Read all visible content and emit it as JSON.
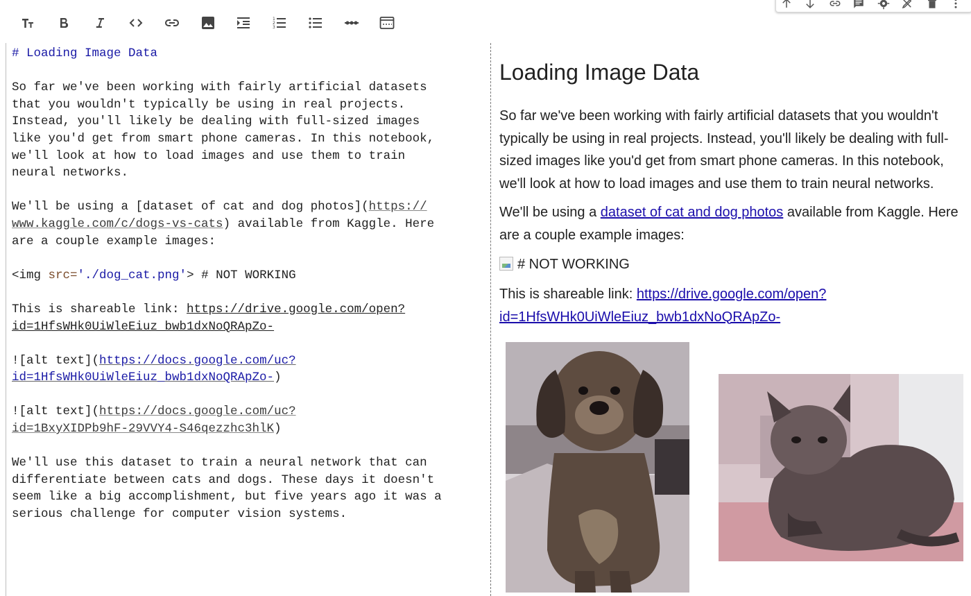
{
  "toolbar": {
    "buttons": [
      {
        "name": "text-size-icon",
        "label": "Heading"
      },
      {
        "name": "bold-icon",
        "label": "Bold"
      },
      {
        "name": "italic-icon",
        "label": "Italic"
      },
      {
        "name": "code-icon",
        "label": "Code"
      },
      {
        "name": "link-icon",
        "label": "Link"
      },
      {
        "name": "image-icon",
        "label": "Image"
      },
      {
        "name": "indent-icon",
        "label": "Indent"
      },
      {
        "name": "numbered-list-icon",
        "label": "Numbered list"
      },
      {
        "name": "bulleted-list-icon",
        "label": "Bulleted list"
      },
      {
        "name": "horizontal-rule-icon",
        "label": "Horizontal rule"
      },
      {
        "name": "preview-layout-icon",
        "label": "Toggle preview"
      }
    ]
  },
  "cell_toolbar": {
    "buttons": [
      "arrow-up-icon",
      "arrow-down-icon",
      "link-icon",
      "comment-icon",
      "settings-icon",
      "edit-icon",
      "delete-icon",
      "more-vert-icon"
    ]
  },
  "editor": {
    "heading": "# Loading Image Data",
    "para1": [
      "So far we've been working with fairly artificial datasets",
      "that you wouldn't typically be using in real projects.",
      "Instead, you'll likely be dealing with full-sized images",
      "like you'd get from smart phone cameras. In this notebook,",
      "we'll look at how to load images and use them to train",
      "neural networks."
    ],
    "para2_a": "We'll be using a [dataset of cat and dog photos](",
    "para2_url1": "https://",
    "para2_url2": "www.kaggle.com/c/dogs-vs-cats",
    "para2_b": ") available from Kaggle. Here",
    "para2_c": "are a couple example images:",
    "img_open": "<img ",
    "img_attr": "src=",
    "img_val": "'./dog_cat.png'",
    "img_close": "> # NOT WORKING",
    "share_prefix": "This is shareable link: ",
    "share_url1": "https://drive.google.com/open?",
    "share_url2": "id=1HfsWHk0UiWleEiuz_bwb1dxNoQRApZo-",
    "alt1_prefix": "![alt text](",
    "alt1_url1": "https://docs.google.com/uc?",
    "alt1_url2": "id=1HfsWHk0UiWleEiuz_bwb1dxNoQRApZo-",
    "alt1_close": ")",
    "alt2_prefix": "![alt text](",
    "alt2_url1": "https://docs.google.com/uc?",
    "alt2_url2": "id=1BxyXIDPb9hF-29VVY4-S46qezzhc3hlK",
    "alt2_close": ")",
    "para3": [
      "We'll use this dataset to train a neural network that can",
      "differentiate between cats and dogs. These days it doesn't",
      "seem like a big accomplishment, but five years ago it was a",
      "serious challenge for computer vision systems."
    ]
  },
  "preview": {
    "heading": "Loading Image Data",
    "para1": "So far we've been working with fairly artificial datasets that you wouldn't typically be using in real projects. Instead, you'll likely be dealing with full-sized images like you'd get from smart phone cameras. In this notebook, we'll look at how to load images and use them to train neural networks.",
    "para2_prefix": "We'll be using a ",
    "para2_link": "dataset of cat and dog photos",
    "para2_suffix": " available from Kaggle. Here are a couple example images:",
    "broken_img_text": "# NOT WORKING",
    "share_prefix": "This is shareable link: ",
    "share_link": "https://drive.google.com/open?id=1HfsWHk0UiWleEiuz_bwb1dxNoQRApZo-",
    "images": [
      {
        "name": "dog-photo",
        "alt": "alt text"
      },
      {
        "name": "cat-photo",
        "alt": "alt text"
      }
    ]
  }
}
